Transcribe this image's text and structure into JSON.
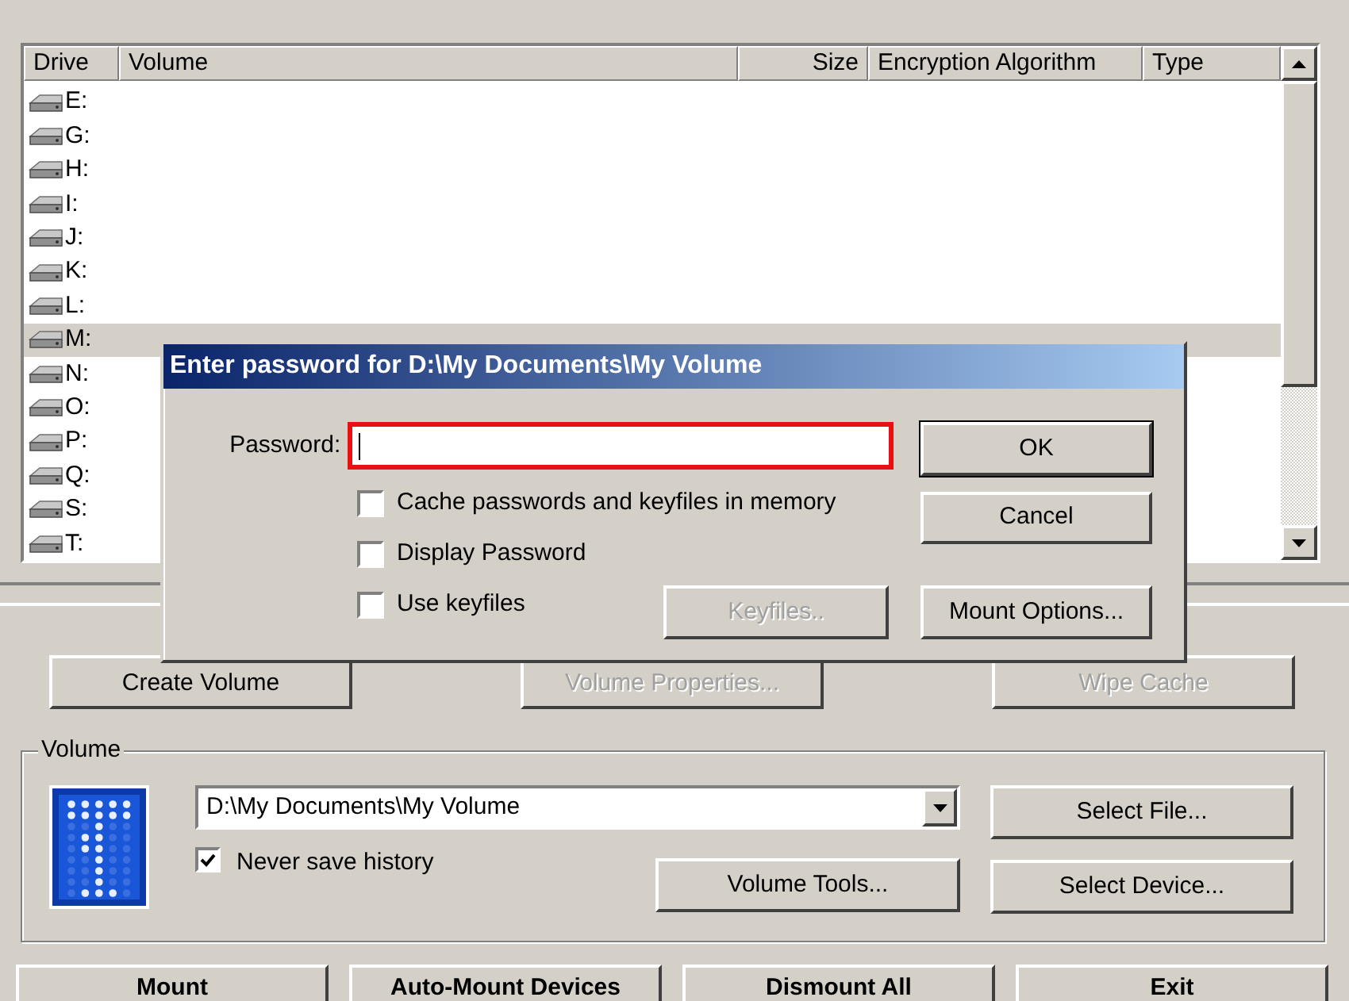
{
  "list": {
    "columns": [
      "Drive",
      "Volume",
      "Size",
      "Encryption Algorithm",
      "Type"
    ],
    "rows": [
      {
        "drive": "E:",
        "selected": false
      },
      {
        "drive": "G:",
        "selected": false
      },
      {
        "drive": "H:",
        "selected": false
      },
      {
        "drive": "I:",
        "selected": false
      },
      {
        "drive": "J:",
        "selected": false
      },
      {
        "drive": "K:",
        "selected": false
      },
      {
        "drive": "L:",
        "selected": false
      },
      {
        "drive": "M:",
        "selected": true
      },
      {
        "drive": "N:",
        "selected": false
      },
      {
        "drive": "O:",
        "selected": false
      },
      {
        "drive": "P:",
        "selected": false
      },
      {
        "drive": "Q:",
        "selected": false
      },
      {
        "drive": "S:",
        "selected": false
      },
      {
        "drive": "T:",
        "selected": false
      }
    ]
  },
  "top_buttons": [
    {
      "label": "Create Volume",
      "disabled": false
    },
    {
      "label": "Volume Properties...",
      "disabled": true
    },
    {
      "label": "Wipe Cache",
      "disabled": true
    }
  ],
  "volume": {
    "title": "Volume",
    "path": "D:\\My Documents\\My Volume",
    "never_save_history": {
      "label": "Never save history",
      "checked": true
    },
    "select_file": "Select File...",
    "volume_tools": "Volume Tools...",
    "select_device": "Select Device..."
  },
  "bottom_buttons": [
    "Mount",
    "Auto-Mount Devices",
    "Dismount All",
    "Exit"
  ],
  "dialog": {
    "title": "Enter password for D:\\My Documents\\My Volume",
    "password_label": "Password:",
    "options": [
      {
        "label": "Cache passwords and keyfiles in memory",
        "checked": false
      },
      {
        "label": "Display Password",
        "checked": false
      },
      {
        "label": "Use keyfiles",
        "checked": false
      }
    ],
    "buttons": [
      {
        "label": "OK",
        "default": true,
        "disabled": false
      },
      {
        "label": "Cancel",
        "default": false,
        "disabled": false
      },
      {
        "label": "Keyfiles..",
        "default": false,
        "disabled": true
      },
      {
        "label": "Mount Options...",
        "default": false,
        "disabled": false
      }
    ]
  }
}
